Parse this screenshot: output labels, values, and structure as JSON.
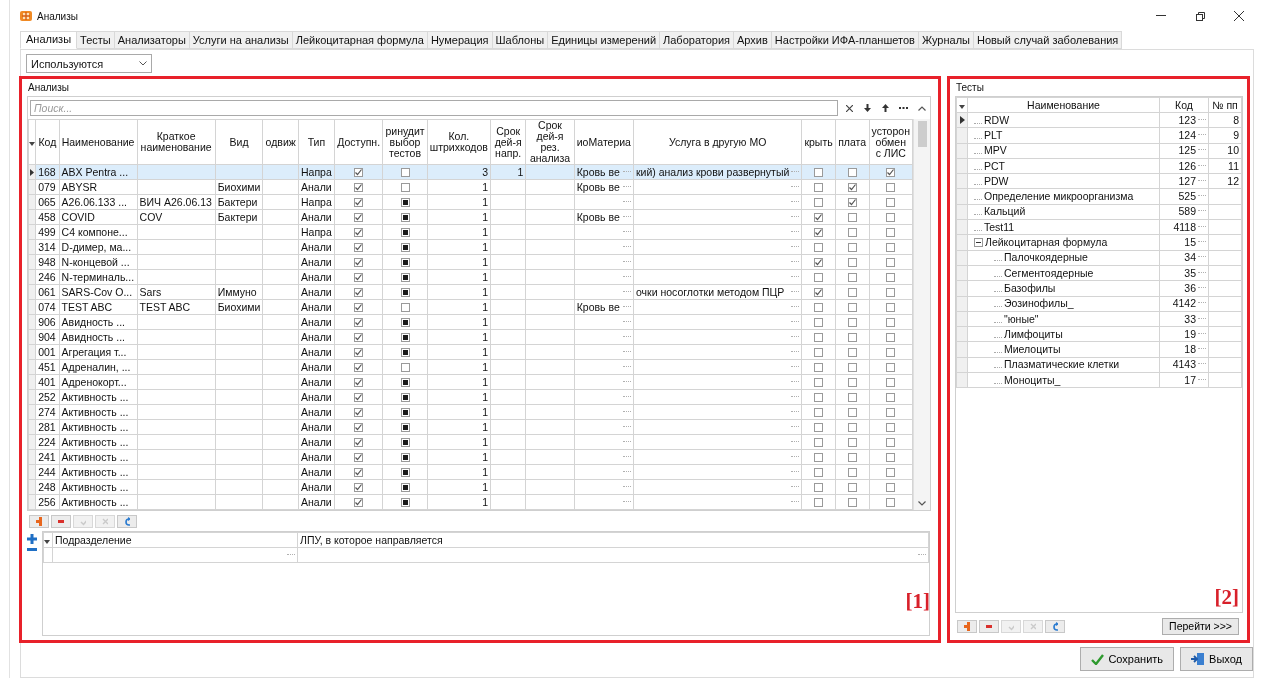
{
  "window": {
    "title": "Анализы"
  },
  "tabs": [
    {
      "label": "Анализы",
      "selected": true
    },
    {
      "label": "Тесты",
      "selected": false
    },
    {
      "label": "Анализаторы",
      "selected": false
    },
    {
      "label": "Услуги на анализы",
      "selected": false
    },
    {
      "label": "Лейкоцитарная формула",
      "selected": false
    },
    {
      "label": "Нумерация",
      "selected": false
    },
    {
      "label": "Шаблоны",
      "selected": false
    },
    {
      "label": "Единицы измерений",
      "selected": false
    },
    {
      "label": "Лаборатория",
      "selected": false
    },
    {
      "label": "Архив",
      "selected": false
    },
    {
      "label": "Настройки ИФА-планшетов",
      "selected": false
    },
    {
      "label": "Журналы",
      "selected": false
    },
    {
      "label": "Новый случай заболевания",
      "selected": false
    }
  ],
  "filter": {
    "value": "Используются"
  },
  "analyses": {
    "title": "Анализы",
    "marker": "[1]",
    "search": {
      "placeholder": "Поиск..."
    },
    "columns": [
      "Код",
      "Наименование",
      "Краткое наименование",
      "Вид",
      "одвиж",
      "Тип",
      "Доступн.",
      "ринудит выбор тестов",
      "Кол. штрихкодов",
      "Срок дей-я напр.",
      "Срок дей-я рез. анализа",
      "иоМатериа",
      "Услуга в другую МО",
      "крыть",
      "плата",
      "усторон обмен с ЛИС"
    ],
    "rows": [
      {
        "selected": true,
        "code": "168",
        "name": "ABX Pentra ...",
        "type_name": "Напра",
        "available": true,
        "forced": false,
        "barcodes": "3",
        "term": "1",
        "material": "Кровь ве",
        "service": "кий) анализ крови развернутый",
        "hidden": false,
        "paid": false,
        "lis": true
      },
      {
        "selected": false,
        "code": "079",
        "name": "ABYSR",
        "category": "Биохими",
        "type_name": "Анали",
        "available": true,
        "forced": false,
        "barcodes": "1",
        "material": "Кровь ве",
        "hidden": false,
        "paid": true,
        "lis": false
      },
      {
        "selected": false,
        "code": "065",
        "name": "A26.06.133 ...",
        "short": "ВИЧ A26.06.13",
        "category": "Бактери",
        "type_name": "Напра",
        "available": true,
        "forced": true,
        "barcodes": "1",
        "hidden": false,
        "paid": true,
        "lis": false
      },
      {
        "selected": false,
        "code": "458",
        "name": "COVID",
        "short": "COV",
        "category": "Бактери",
        "type_name": "Анали",
        "available": true,
        "forced": true,
        "barcodes": "1",
        "material": "Кровь ве",
        "hidden": true,
        "paid": false,
        "lis": false
      },
      {
        "selected": false,
        "code": "499",
        "name": "C4 компоне...",
        "type_name": "Напра",
        "available": true,
        "forced": true,
        "barcodes": "1",
        "hidden": true,
        "paid": false,
        "lis": false
      },
      {
        "selected": false,
        "code": "314",
        "name": "D-димер, ма...",
        "type_name": "Анали",
        "available": true,
        "forced": true,
        "barcodes": "1",
        "hidden": false,
        "paid": false,
        "lis": false
      },
      {
        "selected": false,
        "code": "948",
        "name": "N-концевой ...",
        "type_name": "Анали",
        "available": true,
        "forced": true,
        "barcodes": "1",
        "hidden": true,
        "paid": false,
        "lis": false
      },
      {
        "selected": false,
        "code": "246",
        "name": "N-терминаль...",
        "type_name": "Анали",
        "available": true,
        "forced": true,
        "barcodes": "1",
        "hidden": false,
        "paid": false,
        "lis": false
      },
      {
        "selected": false,
        "code": "061",
        "name": "SARS-Cov O...",
        "short": "Sars",
        "category": "Иммуно",
        "type_name": "Анали",
        "available": true,
        "forced": true,
        "barcodes": "1",
        "service": "очки носоглотки методом ПЦР",
        "hidden": true,
        "paid": false,
        "lis": false
      },
      {
        "selected": false,
        "code": "074",
        "name": "TEST ABC",
        "short": "TEST ABC",
        "category": "Биохими",
        "type_name": "Анали",
        "available": true,
        "forced": false,
        "barcodes": "1",
        "material": "Кровь ве",
        "hidden": false,
        "paid": false,
        "lis": false
      },
      {
        "selected": false,
        "code": "906",
        "name": "Авидность ...",
        "type_name": "Анали",
        "available": true,
        "forced": true,
        "barcodes": "1",
        "hidden": false,
        "paid": false,
        "lis": false
      },
      {
        "selected": false,
        "code": "904",
        "name": "Авидность ...",
        "type_name": "Анали",
        "available": true,
        "forced": true,
        "barcodes": "1",
        "hidden": false,
        "paid": false,
        "lis": false
      },
      {
        "selected": false,
        "code": "001",
        "name": "Агрегация т...",
        "type_name": "Анали",
        "available": true,
        "forced": true,
        "barcodes": "1",
        "hidden": false,
        "paid": false,
        "lis": false
      },
      {
        "selected": false,
        "code": "451",
        "name": "Адреналин, ...",
        "type_name": "Анали",
        "available": true,
        "forced": false,
        "barcodes": "1",
        "hidden": false,
        "paid": false,
        "lis": false
      },
      {
        "selected": false,
        "code": "401",
        "name": "Адренокорт...",
        "type_name": "Анали",
        "available": true,
        "forced": true,
        "barcodes": "1",
        "hidden": false,
        "paid": false,
        "lis": false
      },
      {
        "selected": false,
        "code": "252",
        "name": "Активность ...",
        "type_name": "Анали",
        "available": true,
        "forced": true,
        "barcodes": "1",
        "hidden": false,
        "paid": false,
        "lis": false
      },
      {
        "selected": false,
        "code": "274",
        "name": "Активность ...",
        "type_name": "Анали",
        "available": true,
        "forced": true,
        "barcodes": "1",
        "hidden": false,
        "paid": false,
        "lis": false
      },
      {
        "selected": false,
        "code": "281",
        "name": "Активность ...",
        "type_name": "Анали",
        "available": true,
        "forced": true,
        "barcodes": "1",
        "hidden": false,
        "paid": false,
        "lis": false
      },
      {
        "selected": false,
        "code": "224",
        "name": "Активность ...",
        "type_name": "Анали",
        "available": true,
        "forced": true,
        "barcodes": "1",
        "hidden": false,
        "paid": false,
        "lis": false
      },
      {
        "selected": false,
        "code": "241",
        "name": "Активность ...",
        "type_name": "Анали",
        "available": true,
        "forced": true,
        "barcodes": "1",
        "hidden": false,
        "paid": false,
        "lis": false
      },
      {
        "selected": false,
        "code": "244",
        "name": "Активность ...",
        "type_name": "Анали",
        "available": true,
        "forced": true,
        "barcodes": "1",
        "hidden": false,
        "paid": false,
        "lis": false
      },
      {
        "selected": false,
        "code": "248",
        "name": "Активность ...",
        "type_name": "Анали",
        "available": true,
        "forced": true,
        "barcodes": "1",
        "hidden": false,
        "paid": false,
        "lis": false
      },
      {
        "selected": false,
        "code": "256",
        "name": "Активность ...",
        "type_name": "Анали",
        "available": true,
        "forced": true,
        "barcodes": "1",
        "hidden": false,
        "paid": false,
        "lis": false
      }
    ],
    "toolbar": [
      {
        "kind": "add",
        "disabled": false
      },
      {
        "kind": "remove",
        "disabled": false
      },
      {
        "kind": "apply",
        "disabled": true
      },
      {
        "kind": "cancel",
        "disabled": true
      },
      {
        "kind": "refresh",
        "disabled": false
      }
    ],
    "departments": {
      "columns": [
        "Подразделение",
        "ЛПУ, в которое направляется"
      ]
    }
  },
  "tests": {
    "title": "Тесты",
    "marker": "[2]",
    "columns": [
      "Наименование",
      "Код",
      "№ пп"
    ],
    "items": [
      {
        "name": "RDW",
        "code": "123",
        "number": "8",
        "selected": true
      },
      {
        "name": "PLT",
        "code": "124",
        "number": "9",
        "selected": false
      },
      {
        "name": "MPV",
        "code": "125",
        "number": "10",
        "selected": false
      },
      {
        "name": "PCT",
        "code": "126",
        "number": "11",
        "selected": false
      },
      {
        "name": "PDW",
        "code": "127",
        "number": "12",
        "selected": false
      },
      {
        "name": "Определение микроорганизма",
        "code": "525",
        "selected": false
      },
      {
        "name": "Кальций",
        "code": "589",
        "selected": false
      },
      {
        "name": "Test11",
        "code": "4118",
        "selected": false
      },
      {
        "name": "Лейкоцитарная формула",
        "code": "15",
        "selected": false,
        "expanded": true,
        "children": [
          {
            "name": "Палочкоядерные",
            "code": "34",
            "selected": false
          },
          {
            "name": "Сегментоядерные",
            "code": "35",
            "selected": false
          },
          {
            "name": "Базофилы",
            "code": "36",
            "selected": false
          },
          {
            "name": "Эозинофилы_",
            "code": "4142",
            "selected": false
          },
          {
            "name": "\"юные\"",
            "code": "33",
            "selected": false
          },
          {
            "name": "Лимфоциты",
            "code": "19",
            "selected": false
          },
          {
            "name": "Миелоциты",
            "code": "18",
            "selected": false
          },
          {
            "name": "Плазматические клетки",
            "code": "4143",
            "selected": false
          },
          {
            "name": "Моноциты_",
            "code": "17",
            "selected": false
          }
        ]
      }
    ],
    "toolbar": [
      {
        "kind": "add",
        "disabled": false
      },
      {
        "kind": "remove",
        "disabled": false
      },
      {
        "kind": "apply",
        "disabled": true
      },
      {
        "kind": "cancel",
        "disabled": true
      },
      {
        "kind": "refresh",
        "disabled": false
      }
    ],
    "goto_button": "Перейти >>>"
  },
  "footer": {
    "save": "Сохранить",
    "exit": "Выход"
  }
}
